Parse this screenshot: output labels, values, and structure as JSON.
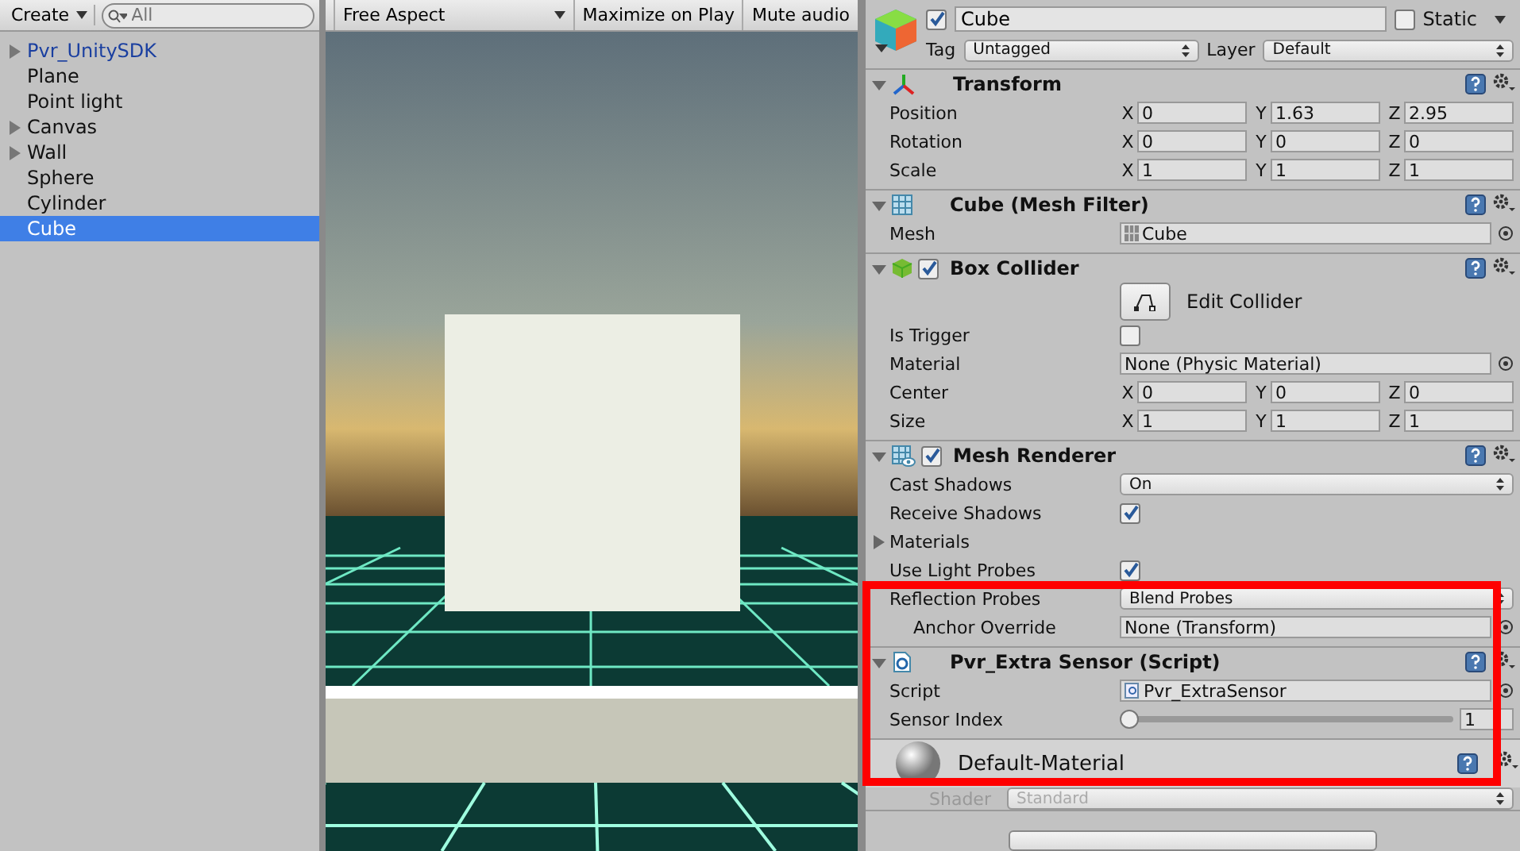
{
  "hierarchy": {
    "create_button": "Create",
    "search": {
      "placeholder": "All"
    },
    "items": [
      {
        "label": "Pvr_UnitySDK",
        "kind": "prefab",
        "has_children": true,
        "selected": false
      },
      {
        "label": "Plane",
        "kind": "object",
        "has_children": false,
        "selected": false
      },
      {
        "label": "Point light",
        "kind": "object",
        "has_children": false,
        "selected": false
      },
      {
        "label": "Canvas",
        "kind": "object",
        "has_children": true,
        "selected": false
      },
      {
        "label": "Wall",
        "kind": "object",
        "has_children": true,
        "selected": false
      },
      {
        "label": "Sphere",
        "kind": "object",
        "has_children": false,
        "selected": false
      },
      {
        "label": "Cylinder",
        "kind": "object",
        "has_children": false,
        "selected": false
      },
      {
        "label": "Cube",
        "kind": "object",
        "has_children": false,
        "selected": true
      }
    ]
  },
  "game_view": {
    "aspect": "Free Aspect",
    "buttons": [
      "Maximize on Play",
      "Mute audio"
    ]
  },
  "inspector": {
    "object": {
      "name": "Cube",
      "active": true,
      "static_label": "Static",
      "static": false,
      "tag_label": "Tag",
      "tag": "Untagged",
      "layer_label": "Layer",
      "layer": "Default"
    },
    "components": [
      {
        "kind": "transform",
        "title": "Transform",
        "rows": [
          {
            "kind": "vector",
            "label": "Position",
            "values": [
              {
                "axis": "X",
                "value": "0"
              },
              {
                "axis": "Y",
                "value": "1.63"
              },
              {
                "axis": "Z",
                "value": "2.95"
              }
            ]
          },
          {
            "kind": "vector",
            "label": "Rotation",
            "values": [
              {
                "axis": "X",
                "value": "0"
              },
              {
                "axis": "Y",
                "value": "0"
              },
              {
                "axis": "Z",
                "value": "0"
              }
            ]
          },
          {
            "kind": "vector",
            "label": "Scale",
            "values": [
              {
                "axis": "X",
                "value": "1"
              },
              {
                "axis": "Y",
                "value": "1"
              },
              {
                "axis": "Z",
                "value": "1"
              }
            ]
          }
        ]
      },
      {
        "kind": "mesh_filter",
        "title": "Cube (Mesh Filter)",
        "rows": [
          {
            "kind": "object",
            "label": "Mesh",
            "value": "Cube"
          }
        ]
      },
      {
        "kind": "collider",
        "title": "Box Collider",
        "enabled": true,
        "rows": [
          {
            "kind": "button",
            "label": "Edit Collider"
          },
          {
            "kind": "checkbox",
            "label": "Is Trigger",
            "checked": false
          },
          {
            "kind": "object",
            "label": "Material",
            "value": "None (Physic Material)"
          },
          {
            "kind": "vector",
            "label": "Center",
            "values": [
              {
                "axis": "X",
                "value": "0"
              },
              {
                "axis": "Y",
                "value": "0"
              },
              {
                "axis": "Z",
                "value": "0"
              }
            ]
          },
          {
            "kind": "vector",
            "label": "Size",
            "values": [
              {
                "axis": "X",
                "value": "1"
              },
              {
                "axis": "Y",
                "value": "1"
              },
              {
                "axis": "Z",
                "value": "1"
              }
            ]
          }
        ]
      },
      {
        "kind": "renderer",
        "title": "Mesh Renderer",
        "enabled": true,
        "rows": [
          {
            "kind": "dropdown",
            "label": "Cast Shadows",
            "value": "On"
          },
          {
            "kind": "checkbox",
            "label": "Receive Shadows",
            "checked": true
          },
          {
            "kind": "foldout",
            "label": "Materials",
            "expanded": false
          },
          {
            "kind": "checkbox",
            "label": "Use Light Probes",
            "checked": true
          },
          {
            "kind": "dropdown",
            "label": "Reflection Probes",
            "value": "Blend Probes"
          },
          {
            "kind": "object",
            "label": "Anchor Override",
            "value": "None (Transform)",
            "indented": true
          }
        ]
      },
      {
        "kind": "script",
        "title": "Pvr_Extra Sensor (Script)",
        "rows": [
          {
            "kind": "object",
            "label": "Script",
            "value": "Pvr_ExtraSensor"
          },
          {
            "kind": "slider",
            "label": "Sensor Index",
            "level": 0,
            "value": "1"
          }
        ]
      }
    ],
    "material": {
      "name": "Default-Material",
      "shader_label": "Shader",
      "shader": "Standard"
    }
  }
}
